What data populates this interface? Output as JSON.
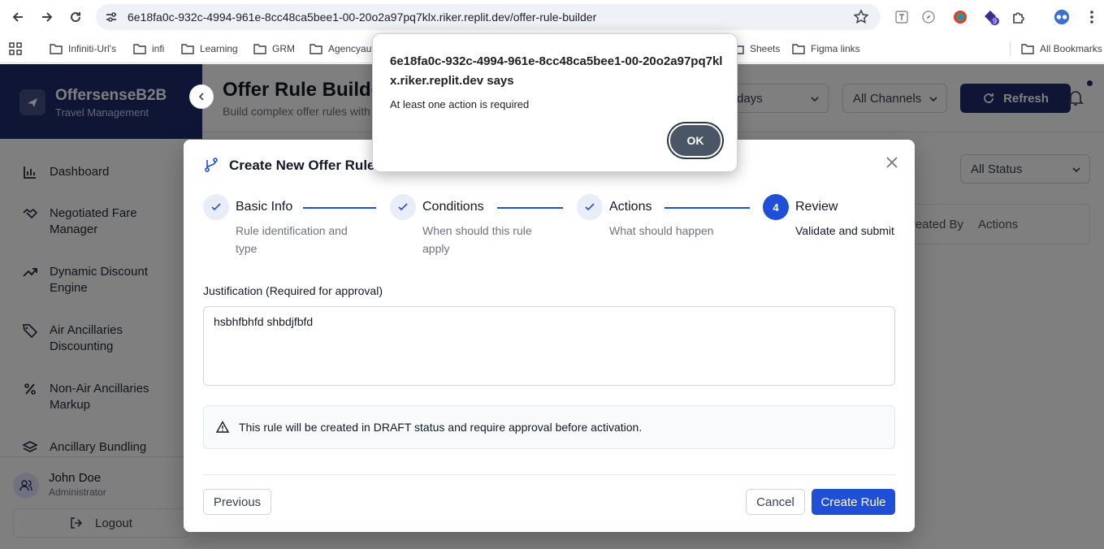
{
  "browser": {
    "url": "6e18fa0c-932c-4994-961e-8cc48ca5bee1-00-20o2a97pq7klx.riker.replit.dev/offer-rule-builder",
    "extension_badge": "9",
    "bookmarks": [
      "Infiniti-Url's",
      "infi",
      "Learning",
      "GRM",
      "Agencyaut",
      "Sheets",
      "Figma links"
    ],
    "all_bookmarks": "All Bookmarks"
  },
  "app": {
    "brand_name": "OffersenseB2B",
    "brand_sub": "Travel Management",
    "nav": [
      {
        "label": "Dashboard",
        "icon": "bar-chart-icon"
      },
      {
        "label": "Negotiated Fare Manager",
        "icon": "handshake-icon"
      },
      {
        "label": "Dynamic Discount Engine",
        "icon": "trending-up-icon"
      },
      {
        "label": "Air Ancillaries Discounting",
        "icon": "tag-icon"
      },
      {
        "label": "Non-Air Ancillaries Markup",
        "icon": "percent-icon"
      },
      {
        "label": "Ancillary Bundling",
        "icon": "layers-icon"
      }
    ],
    "user": {
      "name": "John Doe",
      "role": "Administrator"
    },
    "logout": "Logout",
    "page_title": "Offer Rule Builder",
    "page_sub": "Build complex offer rules with",
    "date_filter": "Last 7 days",
    "channel_filter": "All Channels",
    "refresh": "Refresh",
    "status_filter": "All Status",
    "table_cols": [
      "Created By",
      "Actions"
    ]
  },
  "modal": {
    "title": "Create New Offer Rule",
    "steps": [
      {
        "title": "Basic Info",
        "desc": "Rule identification and type",
        "state": "done"
      },
      {
        "title": "Conditions",
        "desc": "When should this rule apply",
        "state": "done"
      },
      {
        "title": "Actions",
        "desc": "What should happen",
        "state": "done"
      },
      {
        "title": "Review",
        "desc": "Validate and submit",
        "state": "active",
        "number": "4"
      }
    ],
    "justification_label": "Justification (Required for approval)",
    "justification_value": "hsbhfbhfd shbdjfbfd",
    "notice": "This rule will be created in DRAFT status and require approval before activation.",
    "previous": "Previous",
    "cancel": "Cancel",
    "create": "Create Rule"
  },
  "alert": {
    "origin": "6e18fa0c-932c-4994-961e-8cc48ca5bee1-00-20o2a97pq7klx.riker.replit.dev says",
    "message": "At least one action is required",
    "ok": "OK"
  }
}
